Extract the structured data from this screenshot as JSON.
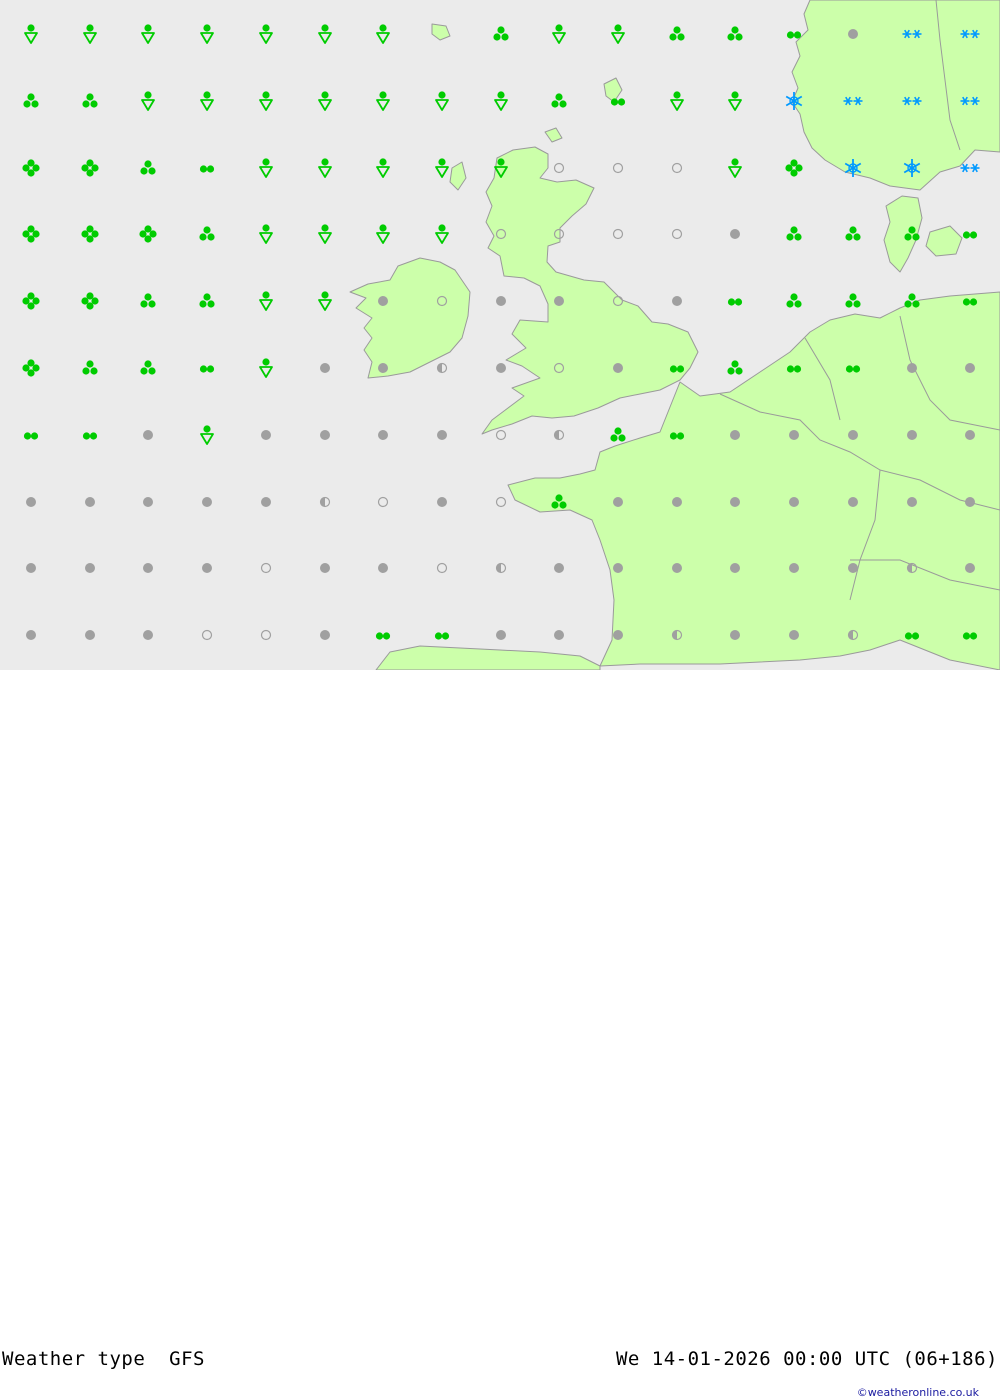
{
  "footer": {
    "title": "Weather type  GFS",
    "datetime": "We 14-01-2026 00:00 UTC (06+186)",
    "credit": "©weatheronline.co.uk"
  },
  "colors": {
    "sea": "#ebebeb",
    "land": "#ccffaa",
    "coast": "#9a9a9a",
    "rain": "#00cc00",
    "snow": "#0099ff",
    "cloud": "#a0a0a0"
  },
  "legend_symbols": {
    "d": "dry-dot",
    "o": "open-circle",
    "h": "half-circle",
    "r": "rain-dots",
    "s": "shower-triangle",
    "c": "three-dot-cluster",
    "k": "four-dot-cluster",
    "a": "snow-asterisks",
    "f": "snowflake"
  },
  "weather_grid": [
    [
      "s",
      "s",
      "s",
      "s",
      "s",
      "s",
      "s",
      "",
      "c",
      "s",
      "s",
      "c",
      "c",
      "r",
      "d",
      "a",
      "a"
    ],
    [
      "c",
      "c",
      "s",
      "s",
      "s",
      "s",
      "s",
      "s",
      "s",
      "c",
      "r",
      "s",
      "s",
      "f",
      "a",
      "a",
      "a"
    ],
    [
      "k",
      "k",
      "c",
      "r",
      "s",
      "s",
      "s",
      "s",
      "s",
      "o",
      "o",
      "o",
      "s",
      "k",
      "f",
      "f",
      "a"
    ],
    [
      "k",
      "k",
      "k",
      "c",
      "s",
      "s",
      "s",
      "s",
      "o",
      "o",
      "o",
      "o",
      "d",
      "c",
      "c",
      "c",
      "r"
    ],
    [
      "k",
      "k",
      "c",
      "c",
      "s",
      "s",
      "d",
      "o",
      "d",
      "d",
      "o",
      "d",
      "r",
      "c",
      "c",
      "c",
      "r"
    ],
    [
      "k",
      "c",
      "c",
      "r",
      "s",
      "d",
      "d",
      "h",
      "d",
      "o",
      "d",
      "r",
      "c",
      "r",
      "r",
      "d",
      "d"
    ],
    [
      "r",
      "r",
      "d",
      "s",
      "d",
      "d",
      "d",
      "d",
      "o",
      "h",
      "c",
      "r",
      "d",
      "d",
      "d",
      "d",
      "d"
    ],
    [
      "d",
      "d",
      "d",
      "d",
      "d",
      "h",
      "o",
      "d",
      "o",
      "c",
      "d",
      "d",
      "d",
      "d",
      "d",
      "d",
      "d"
    ],
    [
      "d",
      "d",
      "d",
      "d",
      "o",
      "d",
      "d",
      "o",
      "h",
      "d",
      "d",
      "d",
      "d",
      "d",
      "d",
      "h",
      "d"
    ],
    [
      "d",
      "d",
      "d",
      "o",
      "o",
      "d",
      "r",
      "r",
      "d",
      "d",
      "d",
      "h",
      "d",
      "d",
      "h",
      "r",
      "r"
    ]
  ]
}
